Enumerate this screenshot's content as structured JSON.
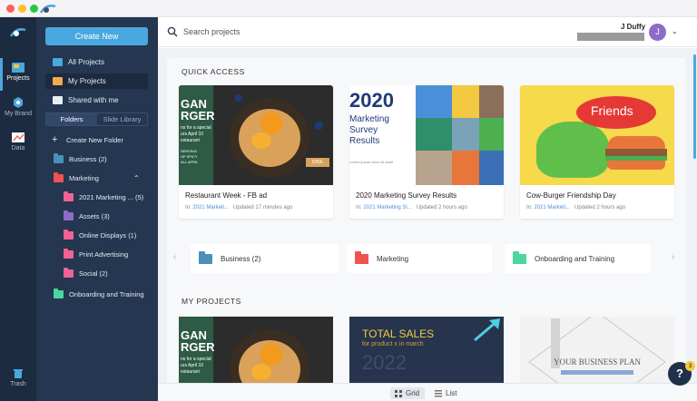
{
  "colors": {
    "rail": "#1c2b3f",
    "sidebar": "#243650",
    "accent": "#4aa8e0",
    "folder_business": "#4a90b8",
    "folder_marketing": "#ef5350",
    "folder_onboarding": "#4cd6a0",
    "folder_pink": "#f06292",
    "folder_purple": "#8e6bc9"
  },
  "rail": {
    "items": [
      {
        "label": "Projects",
        "icon": "projects-icon"
      },
      {
        "label": "My Brand",
        "icon": "brand-icon"
      },
      {
        "label": "Data",
        "icon": "chart-icon"
      },
      {
        "label": "Trash",
        "icon": "trash-icon"
      }
    ]
  },
  "sidebar": {
    "create_label": "Create New",
    "nav": [
      {
        "label": "All Projects"
      },
      {
        "label": "My Projects"
      },
      {
        "label": "Shared with me"
      }
    ],
    "tabs": [
      "Folders",
      "Slide Library"
    ],
    "create_folder": "Create New Folder",
    "folders": [
      {
        "label": "Business (2)"
      },
      {
        "label": "Marketing"
      },
      {
        "label": "2021 Marketing ...",
        "count": "(5)"
      },
      {
        "label": "Assets (3)"
      },
      {
        "label": "Online Displays (1)"
      },
      {
        "label": "Print Advertising"
      },
      {
        "label": "Social (2)"
      },
      {
        "label": "Onboarding and Training"
      }
    ]
  },
  "topbar": {
    "search_placeholder": "Search projects",
    "user_name": "J Duffy",
    "avatar_initial": "J"
  },
  "quick_access": {
    "title": "QUICK ACCESS",
    "cards": [
      {
        "title": "Restaurant Week - FB ad",
        "in_label": "In:",
        "folder": "2021 Marketi...",
        "updated": "Updated 17 minutes ago",
        "thumb": {
          "line1": "GAN",
          "line2": "RGER",
          "body": "ns for a special\nurs April 10\nestaurant",
          "mid": "SERVING\nUP SPICY\nALL APRIL",
          "tag": "DINE"
        }
      },
      {
        "title": "2020 Marketing Survey Results",
        "in_label": "In:",
        "folder": "2021 Marketing Si...",
        "updated": "Updated 2 hours ago",
        "thumb": {
          "year": "2020",
          "sub": "Marketing\nSurvey\nResults",
          "foot": "Lorem ipsum dolor sit amet"
        }
      },
      {
        "title": "Cow-Burger Friendship Day",
        "in_label": "In:",
        "folder": "2021 Marketi...",
        "updated": "Updated 2 hours ago",
        "thumb": {
          "word": "Friends"
        }
      }
    ]
  },
  "folder_strip": [
    {
      "label": "Business (2)"
    },
    {
      "label": "Marketing"
    },
    {
      "label": "Onboarding and Training"
    }
  ],
  "my_projects": {
    "title": "MY PROJECTS",
    "cards": [
      {
        "thumb": {
          "line1": "GAN",
          "line2": "RGER",
          "body": "ns for a special\nurs April 10\nestaurant"
        }
      },
      {
        "thumb": {
          "line1": "TOTAL SALES",
          "line2": "for product x in march",
          "year": "2022"
        }
      },
      {
        "thumb": {
          "title": "YOUR BUSINESS PLAN"
        }
      }
    ]
  },
  "view_modes": {
    "grid": "Grid",
    "list": "List"
  },
  "help": {
    "label": "?",
    "badge": "3"
  }
}
